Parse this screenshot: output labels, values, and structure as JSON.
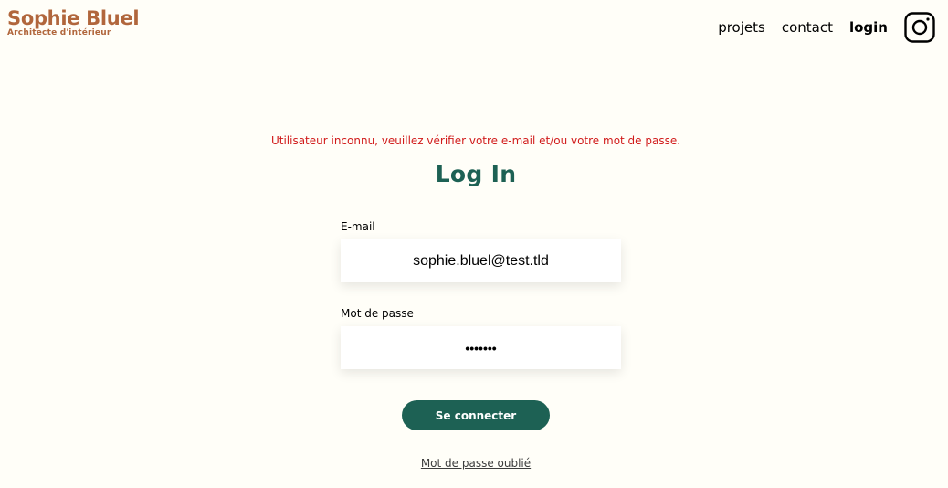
{
  "brand": {
    "name": "Sophie Bluel",
    "subtitle": "Architecte d'intérieur",
    "color": "#b1663c"
  },
  "nav": {
    "items": [
      {
        "label": "projets"
      },
      {
        "label": "contact"
      },
      {
        "label": "login",
        "active": true
      }
    ],
    "social_icon": "instagram-icon"
  },
  "login": {
    "error_message": "Utilisateur inconnu, veuillez vérifier votre e-mail et/ou votre mot de passe.",
    "title": "Log In",
    "email_label": "E-mail",
    "email_value": "sophie.bluel@test.tld",
    "password_label": "Mot de passe",
    "password_value": "•••••••",
    "submit_label": "Se connecter",
    "forgot_label": "Mot de passe oublié"
  },
  "colors": {
    "background": "#fffef8",
    "accent": "#1d6154",
    "error": "#d11b1b"
  }
}
